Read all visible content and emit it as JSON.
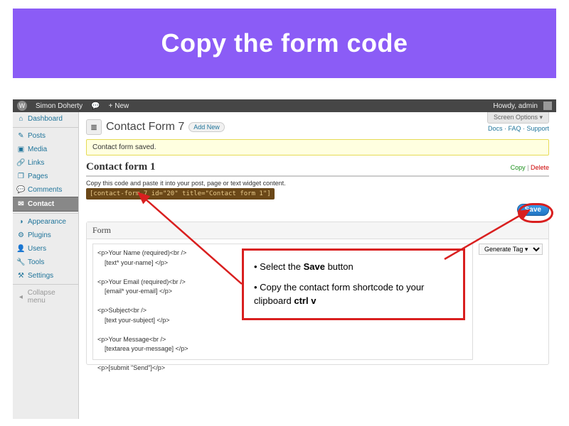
{
  "banner": {
    "title": "Copy the form code"
  },
  "adminbar": {
    "site": "Simon Doherty",
    "plus": "+",
    "new": "New",
    "howdy": "Howdy, admin"
  },
  "screen_options": {
    "tab": "Screen Options ▾",
    "help": "Docs · FAQ · Support"
  },
  "page": {
    "icon": "≣",
    "title": "Contact Form 7",
    "addnew": "Add New"
  },
  "notice": "Contact form saved.",
  "form": {
    "title": "Contact form 1",
    "copy": "Copy",
    "delete": "Delete",
    "hint": "Copy this code and paste it into your post, page or text widget content.",
    "shortcode": "[contact-form-7 id=\"20\" title=\"Contact form 1\"]",
    "save": "Save",
    "section": "Form",
    "generate": "Generate Tag ▾",
    "textarea": "<p>Your Name (required)<br />\n    [text* your-name] </p>\n\n<p>Your Email (required)<br />\n    [email* your-email] </p>\n\n<p>Subject<br />\n    [text your-subject] </p>\n\n<p>Your Message<br />\n    [textarea your-message] </p>\n\n<p>[submit \"Send\"]</p>"
  },
  "sidebar": {
    "items": [
      {
        "icon": "⌂",
        "label": "Dashboard"
      },
      {
        "icon": "✎",
        "label": "Posts"
      },
      {
        "icon": "▣",
        "label": "Media"
      },
      {
        "icon": "🔗",
        "label": "Links"
      },
      {
        "icon": "❐",
        "label": "Pages"
      },
      {
        "icon": "💬",
        "label": "Comments"
      },
      {
        "icon": "✉",
        "label": "Contact",
        "active": true
      },
      {
        "icon": "◑",
        "label": "Appearance"
      },
      {
        "icon": "⚙",
        "label": "Plugins"
      },
      {
        "icon": "👤",
        "label": "Users"
      },
      {
        "icon": "🔧",
        "label": "Tools"
      },
      {
        "icon": "⚒",
        "label": "Settings"
      }
    ],
    "collapse": "Collapse menu"
  },
  "annotation": {
    "line1a": "• Select the ",
    "line1b": "Save",
    "line1c": " button",
    "line2a": "• Copy the contact form shortcode to your clipboard ",
    "line2b": "ctrl v"
  }
}
